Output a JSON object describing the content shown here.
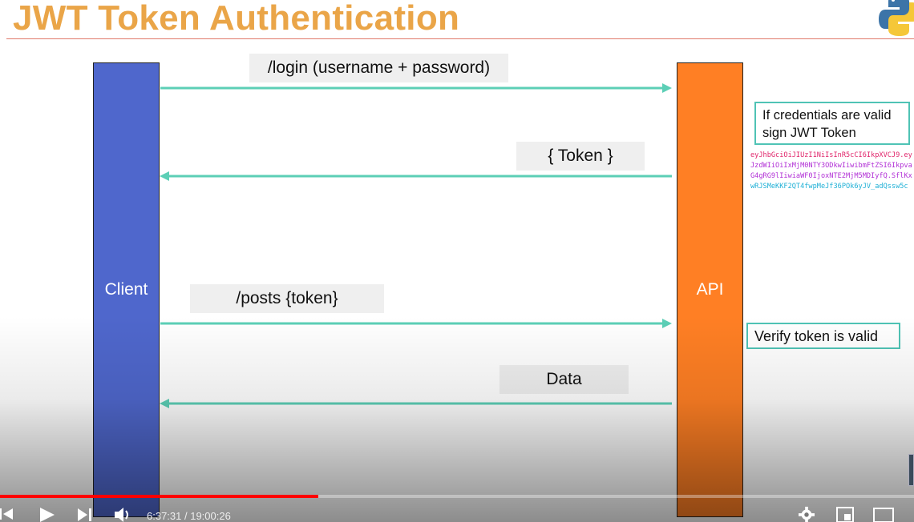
{
  "slide": {
    "title": "JWT Token Authentication",
    "client_label": "Client",
    "api_label": "API",
    "messages": {
      "login": "/login (username + password)",
      "token": "{ Token }",
      "posts": "/posts  {token}",
      "data": "Data"
    },
    "notes": {
      "sign_line1": "If credentials are valid",
      "sign_line2": "sign JWT Token",
      "verify": "Verify token is valid"
    },
    "jwt_lines": [
      {
        "text": "eyJhbGciOiJIUzI1NiIsInR5cCI6IkpXVCJ9.ey",
        "color": "#e0246a"
      },
      {
        "text": "JzdWIiOiIxMjM0NTY3ODkwIiwibmFtZSI6Ikpva",
        "color": "#b12fd6"
      },
      {
        "text": "G4gRG9lIiwiaWF0IjoxNTE2MjM5MDIyfQ.SflKx",
        "color": "#b12fd6"
      },
      {
        "text": "wRJSMeKKF2QT4fwpMeJf36POk6yJV_adQssw5c",
        "color": "#1fb0d6"
      }
    ],
    "colors": {
      "title": "#eaa548",
      "client": "#4f67cc",
      "api": "#ff7f24",
      "arrow": "#5ccfb6"
    }
  },
  "player": {
    "time_display": "6:37:31 / 19:00:26",
    "progress": 0.348,
    "icons": [
      "skip-back-icon",
      "play-icon",
      "next-icon",
      "volume-icon",
      "gear-icon",
      "miniplayer-icon",
      "theater-icon"
    ]
  }
}
